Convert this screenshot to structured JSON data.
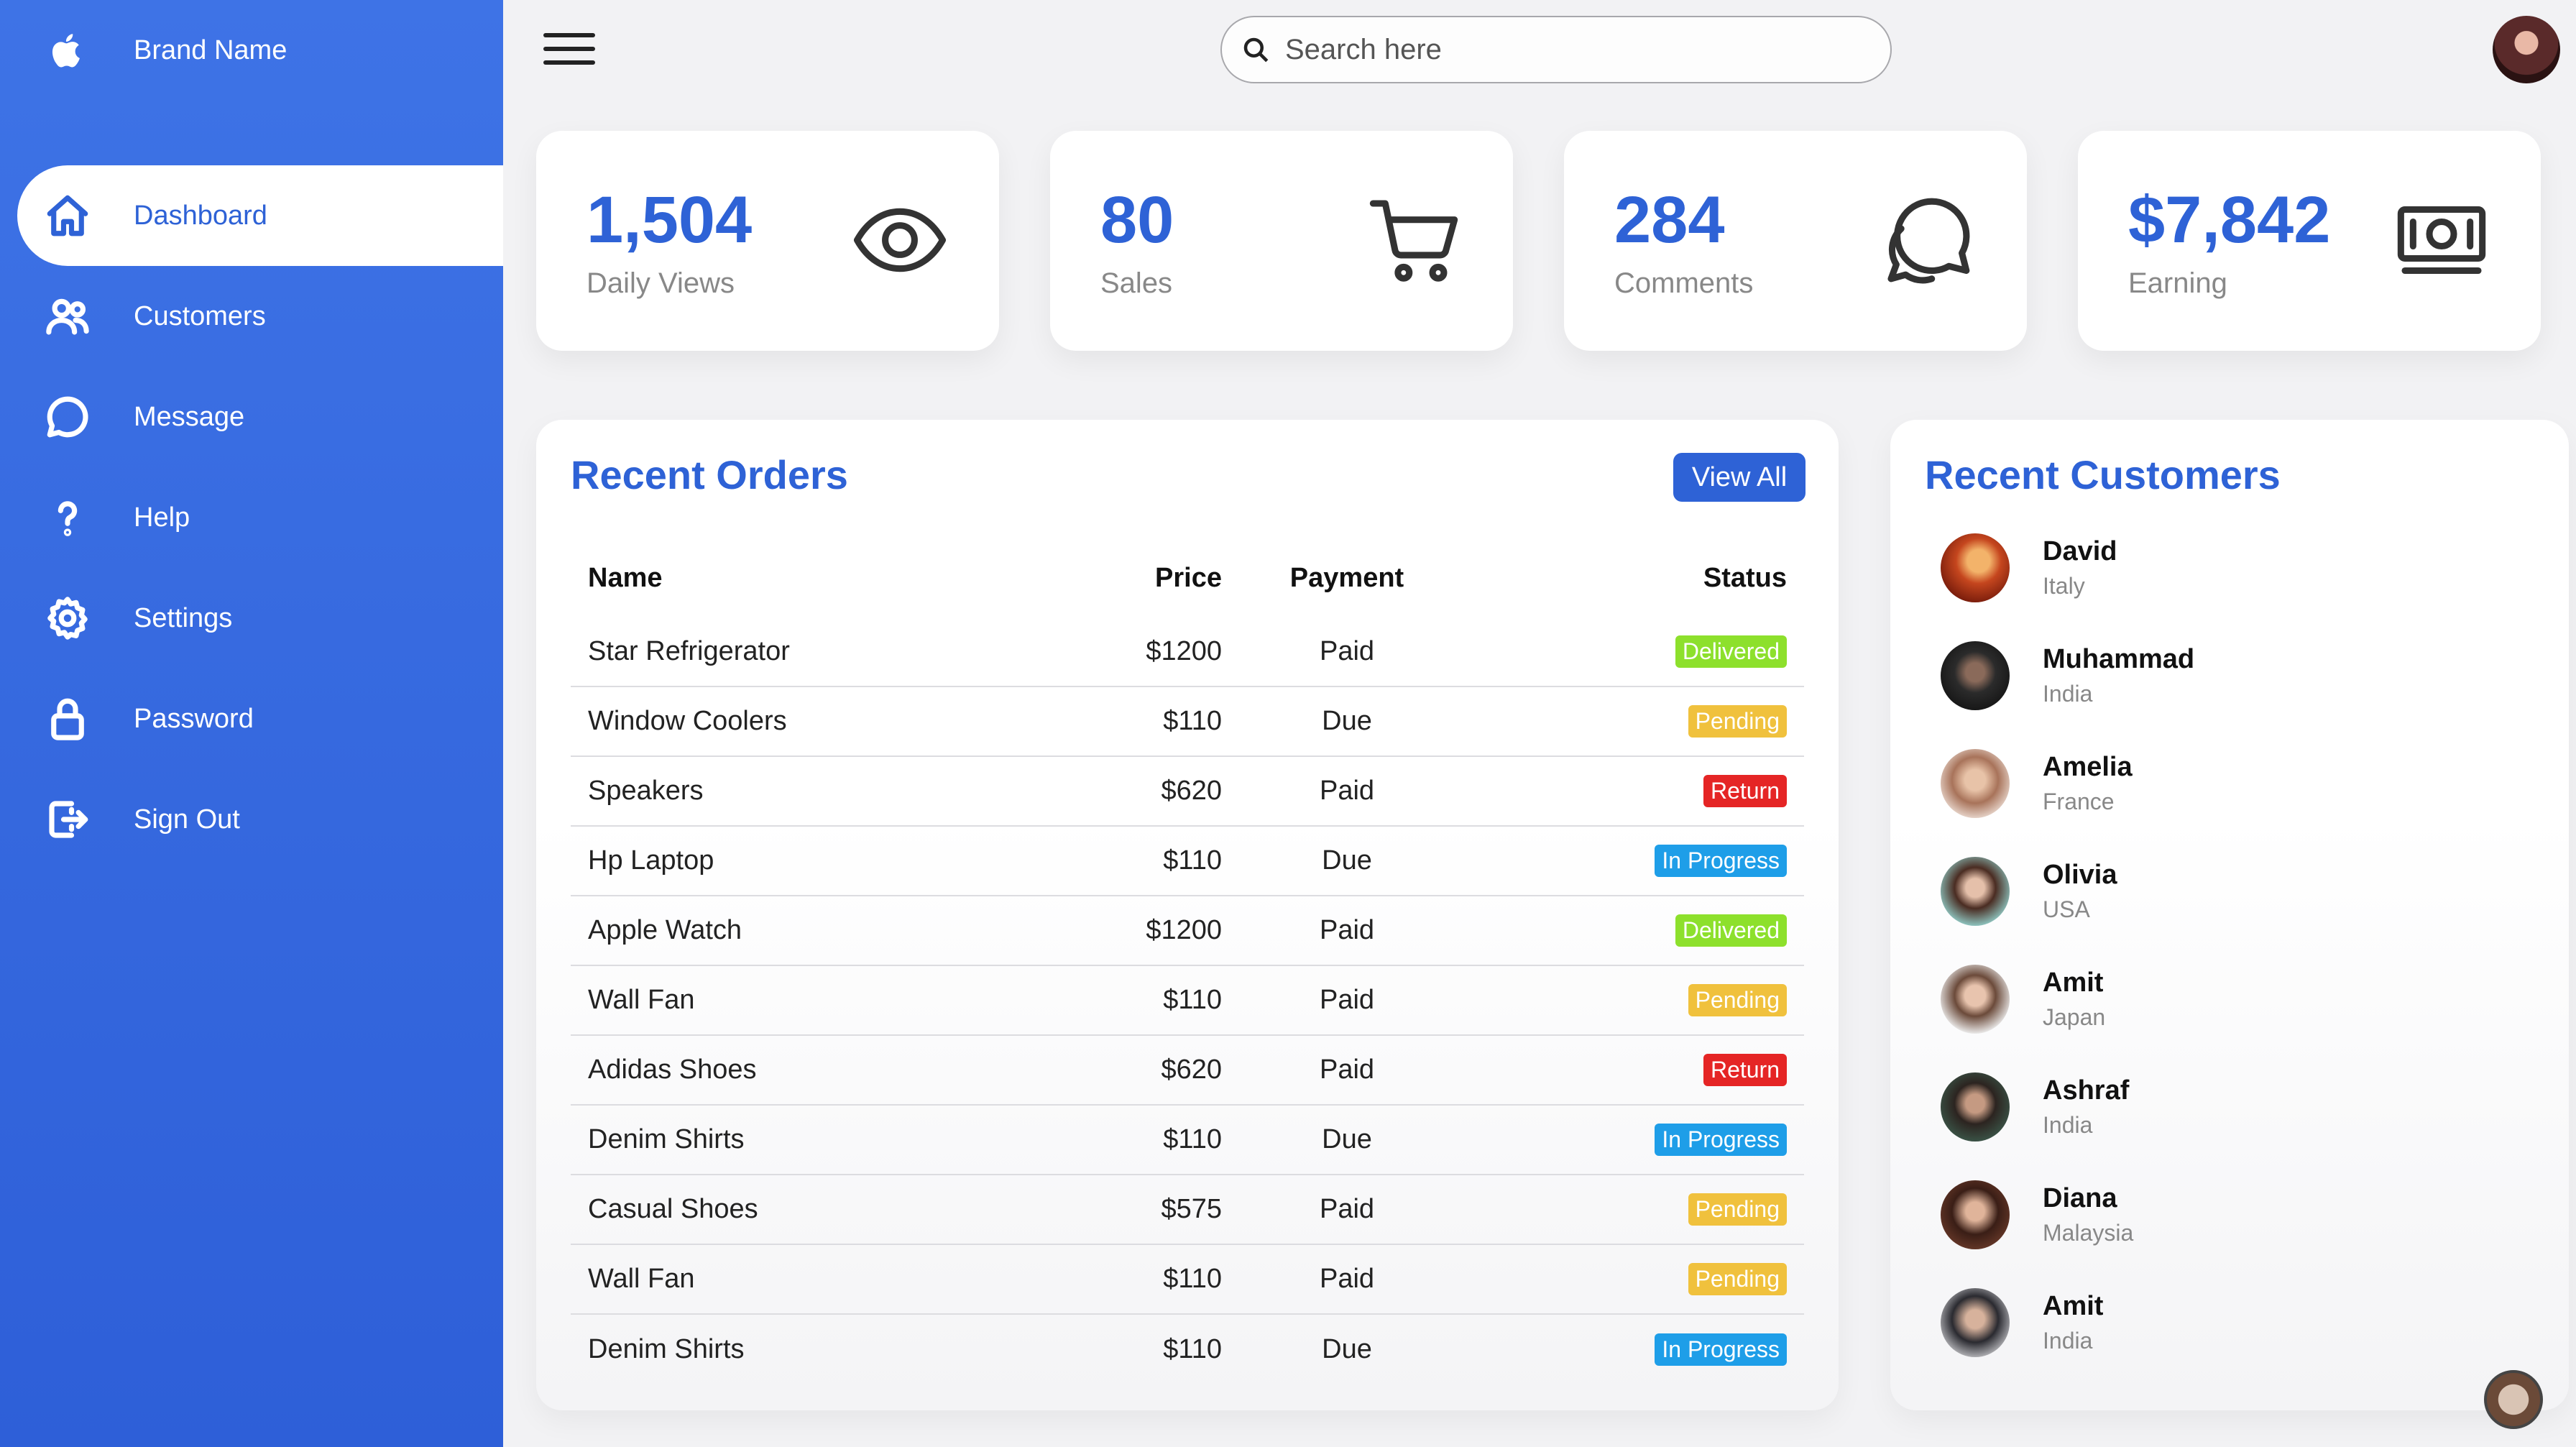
{
  "sidebar": {
    "brand": "Brand Name",
    "items": [
      {
        "label": "Dashboard",
        "icon": "home-icon"
      },
      {
        "label": "Customers",
        "icon": "people-icon"
      },
      {
        "label": "Message",
        "icon": "chat-icon"
      },
      {
        "label": "Help",
        "icon": "help-icon"
      },
      {
        "label": "Settings",
        "icon": "gear-icon"
      },
      {
        "label": "Password",
        "icon": "lock-icon"
      },
      {
        "label": "Sign Out",
        "icon": "sign-out-icon"
      }
    ]
  },
  "search": {
    "placeholder": "Search here"
  },
  "cards": [
    {
      "value": "1,504",
      "label": "Daily Views",
      "icon": "eye-icon"
    },
    {
      "value": "80",
      "label": "Sales",
      "icon": "cart-icon"
    },
    {
      "value": "284",
      "label": "Comments",
      "icon": "comments-icon"
    },
    {
      "value": "$7,842",
      "label": "Earning",
      "icon": "money-icon"
    }
  ],
  "orders": {
    "title": "Recent Orders",
    "view_all": "View All",
    "headers": {
      "name": "Name",
      "price": "Price",
      "payment": "Payment",
      "status": "Status"
    },
    "rows": [
      {
        "name": "Star Refrigerator",
        "price": "$1200",
        "payment": "Paid",
        "status": "Delivered"
      },
      {
        "name": "Window Coolers",
        "price": "$110",
        "payment": "Due",
        "status": "Pending"
      },
      {
        "name": "Speakers",
        "price": "$620",
        "payment": "Paid",
        "status": "Return"
      },
      {
        "name": "Hp Laptop",
        "price": "$110",
        "payment": "Due",
        "status": "In Progress"
      },
      {
        "name": "Apple Watch",
        "price": "$1200",
        "payment": "Paid",
        "status": "Delivered"
      },
      {
        "name": "Wall Fan",
        "price": "$110",
        "payment": "Paid",
        "status": "Pending"
      },
      {
        "name": "Adidas Shoes",
        "price": "$620",
        "payment": "Paid",
        "status": "Return"
      },
      {
        "name": "Denim Shirts",
        "price": "$110",
        "payment": "Due",
        "status": "In Progress"
      },
      {
        "name": "Casual Shoes",
        "price": "$575",
        "payment": "Paid",
        "status": "Pending"
      },
      {
        "name": "Wall Fan",
        "price": "$110",
        "payment": "Paid",
        "status": "Pending"
      },
      {
        "name": "Denim Shirts",
        "price": "$110",
        "payment": "Due",
        "status": "In Progress"
      }
    ]
  },
  "customers": {
    "title": "Recent Customers",
    "list": [
      {
        "name": "David",
        "country": "Italy"
      },
      {
        "name": "Muhammad",
        "country": "India"
      },
      {
        "name": "Amelia",
        "country": "France"
      },
      {
        "name": "Olivia",
        "country": "USA"
      },
      {
        "name": "Amit",
        "country": "Japan"
      },
      {
        "name": "Ashraf",
        "country": "India"
      },
      {
        "name": "Diana",
        "country": "Malaysia"
      },
      {
        "name": "Amit",
        "country": "India"
      }
    ]
  },
  "colors": {
    "primary": "#2e62d6",
    "delivered": "#8de02c",
    "pending": "#f0c13d",
    "return": "#e52525",
    "in_progress": "#1e9ee8"
  }
}
